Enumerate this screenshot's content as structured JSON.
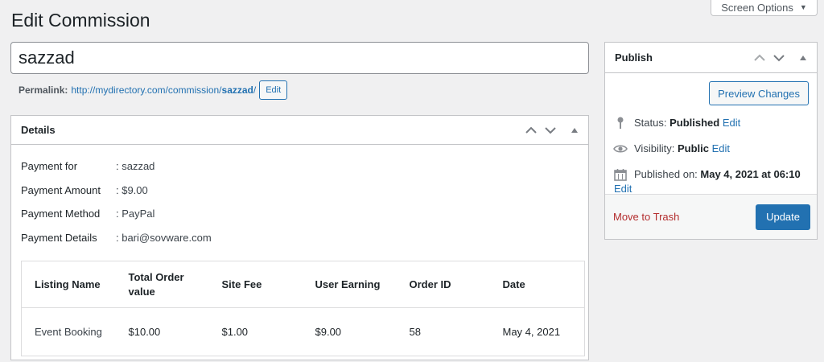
{
  "screen_options": {
    "label": "Screen Options"
  },
  "page": {
    "title": "Edit Commission"
  },
  "post": {
    "title_value": "sazzad"
  },
  "permalink": {
    "label": "Permalink:",
    "url_base": "http://mydirectory.com/commission/",
    "slug": "sazzad",
    "url_trailing": "/",
    "edit_label": "Edit"
  },
  "details": {
    "heading": "Details",
    "rows": [
      {
        "key": "Payment for",
        "value": ": sazzad"
      },
      {
        "key": "Payment Amount",
        "value": ": $9.00"
      },
      {
        "key": "Payment Method",
        "value": ": PayPal"
      },
      {
        "key": "Payment Details",
        "value": ": bari@sovware.com"
      }
    ],
    "table": {
      "headers": [
        "Listing Name",
        "Total Order value",
        "Site Fee",
        "User Earning",
        "Order ID",
        "Date"
      ],
      "rows": [
        [
          "Event Booking",
          "$10.00",
          "$1.00",
          "$9.00",
          "58",
          "May 4, 2021"
        ]
      ]
    }
  },
  "publish": {
    "heading": "Publish",
    "preview_label": "Preview Changes",
    "status_label": "Status:",
    "status_value": "Published",
    "visibility_label": "Visibility:",
    "visibility_value": "Public",
    "published_on_label": "Published on:",
    "published_on_value": "May 4, 2021 at 06:10",
    "edit_label": "Edit",
    "trash_label": "Move to Trash",
    "update_label": "Update"
  },
  "icons": {
    "pin": "pin-icon",
    "eye": "eye-icon",
    "calendar": "calendar-icon",
    "chevron_up": "chevron-up-icon",
    "chevron_down": "chevron-down-icon",
    "toggle": "triangle-up-icon"
  },
  "colors": {
    "accent": "#2271b1",
    "danger": "#b32d2e",
    "background": "#f0f0f1"
  }
}
